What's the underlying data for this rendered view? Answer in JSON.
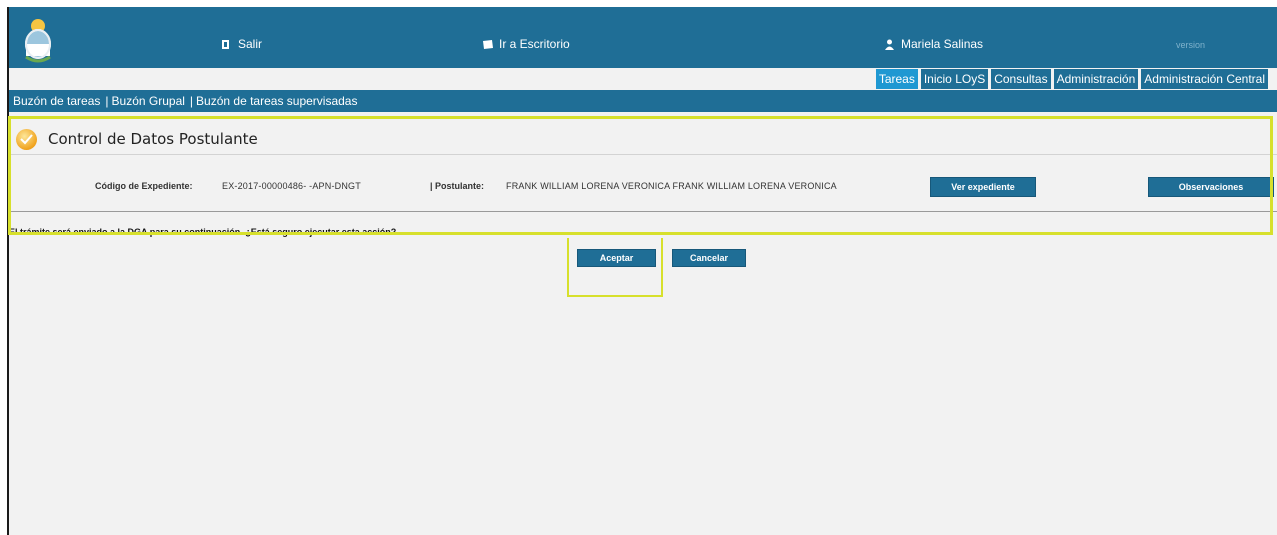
{
  "header": {
    "salir": "Salir",
    "escritorio": "Ir a Escritorio",
    "user": "Mariela Salinas",
    "version": "version"
  },
  "tabs": [
    {
      "label": "Tareas",
      "active": true
    },
    {
      "label": "Inicio LOyS",
      "active": false
    },
    {
      "label": "Consultas",
      "active": false
    },
    {
      "label": "Administración",
      "active": false
    },
    {
      "label": "Administración Central",
      "active": false
    }
  ],
  "subnav": [
    "Buzón de tareas",
    "Buzón Grupal",
    "Buzón de tareas supervisadas"
  ],
  "panel": {
    "title": "Control de Datos Postulante",
    "codigo_label": "Código de Expediente:",
    "codigo_value": "EX-2017-00000486- -APN-DNGT",
    "postulante_label": "| Postulante:",
    "postulante_value": "FRANK WILLIAM LORENA VERONICA FRANK WILLIAM LORENA VERONICA",
    "ver_button": "Ver expediente",
    "obs_button": "Observaciones",
    "question": "El trámite será enviado a la DGA para su continuación. ¿Está seguro ejecutar esta acción?",
    "aceptar": "Aceptar",
    "cancelar": "Cancelar"
  },
  "colors": {
    "primary": "#1f6e96",
    "active_tab": "#1f98d2",
    "highlight": "#d7e02c"
  },
  "icons": {
    "logo": "argentina-coat-of-arms",
    "salir": "exit-icon",
    "escritorio": "desk-icon",
    "user": "user-icon",
    "title": "checkmark-badge-icon"
  }
}
